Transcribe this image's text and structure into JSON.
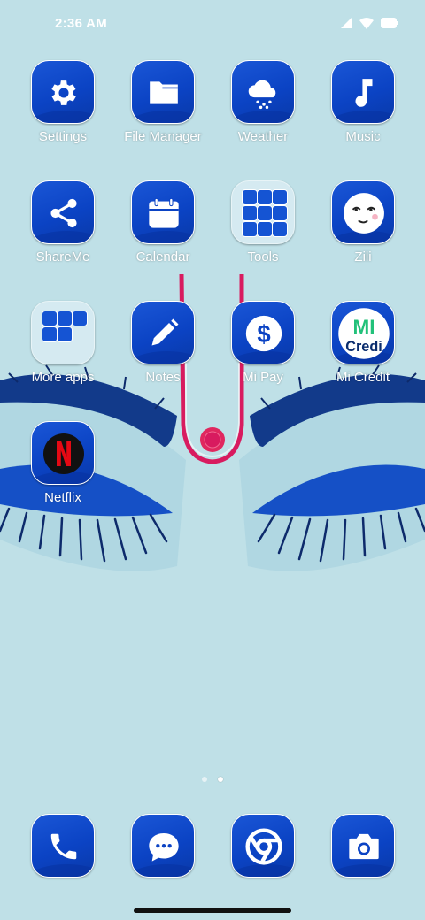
{
  "status_bar": {
    "time": "2:36 AM"
  },
  "apps": {
    "settings": {
      "label": "Settings",
      "icon": "gear-icon"
    },
    "file_manager": {
      "label": "File Manager",
      "icon": "folder-icon"
    },
    "weather": {
      "label": "Weather",
      "icon": "cloud-icon"
    },
    "music": {
      "label": "Music",
      "icon": "music-note-icon"
    },
    "shareme": {
      "label": "ShareMe",
      "icon": "share-icon"
    },
    "calendar": {
      "label": "Calendar",
      "icon": "calendar-icon"
    },
    "tools": {
      "label": "Tools",
      "icon": "folder-icon"
    },
    "zili": {
      "label": "Zili",
      "icon": "smiley-icon"
    },
    "more_apps": {
      "label": "More apps",
      "icon": "folder-icon"
    },
    "notes": {
      "label": "Notes",
      "icon": "pencil-icon"
    },
    "mi_pay": {
      "label": "Mi Pay",
      "icon": "dollar-icon"
    },
    "mi_credit": {
      "label": "Mi Credit",
      "icon": "mi-credit-logo-icon",
      "logo_text": "MI",
      "logo_text2": "Credi"
    },
    "netflix": {
      "label": "Netflix",
      "icon": "netflix-icon"
    }
  },
  "dock": [
    {
      "name": "phone",
      "icon": "phone-icon"
    },
    {
      "name": "messages",
      "icon": "message-icon"
    },
    {
      "name": "chrome",
      "icon": "chrome-icon"
    },
    {
      "name": "camera",
      "icon": "camera-icon"
    }
  ],
  "page_indicator": {
    "pages": 2,
    "current": 2
  },
  "colors": {
    "background": "#bfe0e7",
    "icon_blue": "#0b43c4",
    "tilak_pink": "#d81b5f",
    "lash_navy": "#0d2a6b"
  }
}
